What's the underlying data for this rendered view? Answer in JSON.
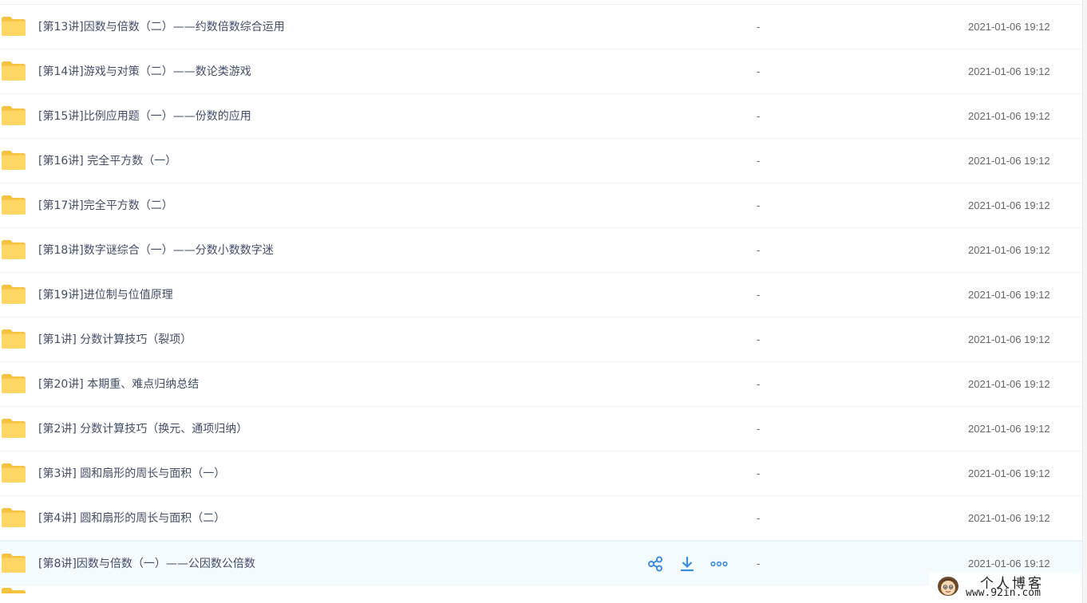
{
  "files": [
    {
      "name": "[第13讲]因数与倍数（二）——约数倍数综合运用",
      "size": "-",
      "date": "2021-01-06 19:12"
    },
    {
      "name": "[第14讲]游戏与对策（二）——数论类游戏",
      "size": "-",
      "date": "2021-01-06 19:12"
    },
    {
      "name": "[第15讲]比例应用题（一）——份数的应用",
      "size": "-",
      "date": "2021-01-06 19:12"
    },
    {
      "name": "[第16讲] 完全平方数（一）",
      "size": "-",
      "date": "2021-01-06 19:12"
    },
    {
      "name": "[第17讲]完全平方数（二）",
      "size": "-",
      "date": "2021-01-06 19:12"
    },
    {
      "name": "[第18讲]数字谜综合（一）——分数小数数字迷",
      "size": "-",
      "date": "2021-01-06 19:12"
    },
    {
      "name": "[第19讲]进位制与位值原理",
      "size": "-",
      "date": "2021-01-06 19:12"
    },
    {
      "name": "[第1讲] 分数计算技巧（裂项）",
      "size": "-",
      "date": "2021-01-06 19:12"
    },
    {
      "name": "[第20讲] 本期重、难点归纳总结",
      "size": "-",
      "date": "2021-01-06 19:12"
    },
    {
      "name": "[第2讲] 分数计算技巧（换元、通项归纳）",
      "size": "-",
      "date": "2021-01-06 19:12"
    },
    {
      "name": "[第3讲] 圆和扇形的周长与面积（一）",
      "size": "-",
      "date": "2021-01-06 19:12"
    },
    {
      "name": "[第4讲] 圆和扇形的周长与面积（二）",
      "size": "-",
      "date": "2021-01-06 19:12"
    },
    {
      "name": "[第8讲]因数与倍数（一）——公因数公倍数",
      "size": "-",
      "date": "2021-01-06 19:12",
      "hovered": true
    }
  ],
  "row_actions": {
    "share_icon": "share-icon",
    "download_icon": "download-icon",
    "more_icon": "more-icon"
  },
  "colors": {
    "folder": "#ffd564",
    "folder_dark": "#f5c242",
    "action": "#3b8cde",
    "text": "#424e67",
    "hover_bg": "#f4fbff"
  },
  "watermark": {
    "title": "个人博客",
    "url": "www.92in.com"
  }
}
